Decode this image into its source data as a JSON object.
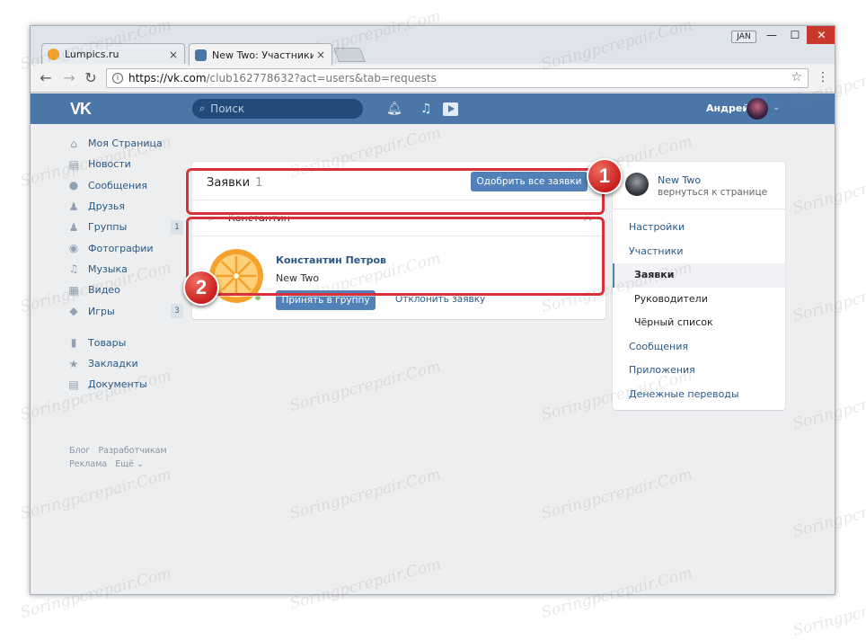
{
  "browser": {
    "tabs": [
      {
        "title": "Lumpics.ru",
        "favicon_color": "#f5a22d"
      },
      {
        "title": "New Two: Участники",
        "favicon_color": "#4a76a8"
      }
    ],
    "close_glyph": "×",
    "user_badge": "JAN",
    "window_controls": {
      "minimize": "—",
      "maximize": "☐",
      "close": "✕"
    },
    "url_host": "https://vk.com",
    "url_path": "/club162778632?act=users&tab=requests"
  },
  "vk_header": {
    "logo": "VK",
    "search_placeholder": "Поиск",
    "user_name": "Андрей"
  },
  "left_nav": {
    "items": [
      {
        "label": "Моя Страница",
        "icon": "home-icon",
        "glyph": "⌂",
        "count": ""
      },
      {
        "label": "Новости",
        "icon": "news-icon",
        "glyph": "▤",
        "count": ""
      },
      {
        "label": "Сообщения",
        "icon": "messages-icon",
        "glyph": "●",
        "count": ""
      },
      {
        "label": "Друзья",
        "icon": "friends-icon",
        "glyph": "♟",
        "count": ""
      },
      {
        "label": "Группы",
        "icon": "groups-icon",
        "glyph": "♟",
        "count": "1"
      },
      {
        "label": "Фотографии",
        "icon": "camera-icon",
        "glyph": "◉",
        "count": ""
      },
      {
        "label": "Музыка",
        "icon": "music-icon",
        "glyph": "♫",
        "count": ""
      },
      {
        "label": "Видео",
        "icon": "video-icon",
        "glyph": "▦",
        "count": ""
      },
      {
        "label": "Игры",
        "icon": "games-icon",
        "glyph": "◆",
        "count": "3"
      }
    ],
    "items2": [
      {
        "label": "Товары",
        "icon": "bag-icon",
        "glyph": "▮"
      },
      {
        "label": "Закладки",
        "icon": "star-icon",
        "glyph": "★"
      },
      {
        "label": "Документы",
        "icon": "document-icon",
        "glyph": "▤"
      }
    ],
    "footer": {
      "blog": "Блог",
      "dev": "Разработчикам",
      "ads": "Реклама",
      "more": "Ещё ⌄"
    }
  },
  "requests": {
    "title": "Заявки",
    "count": "1",
    "approve_all": "Одобрить все заявки",
    "search_value": "Константин",
    "request": {
      "name": "Константин Петров",
      "group": "New Two",
      "accept": "Принять в группу",
      "decline": "Отклонить заявку"
    }
  },
  "right_menu": {
    "group_name": "New Two",
    "back": "вернуться к странице",
    "items": [
      {
        "label": "Настройки",
        "kind": "top"
      },
      {
        "label": "Участники",
        "kind": "top"
      },
      {
        "label": "Заявки",
        "kind": "selected"
      },
      {
        "label": "Руководители",
        "kind": "sub"
      },
      {
        "label": "Чёрный список",
        "kind": "sub"
      },
      {
        "label": "Сообщения",
        "kind": "top"
      },
      {
        "label": "Приложения",
        "kind": "top"
      },
      {
        "label": "Денежные переводы",
        "kind": "top"
      }
    ]
  },
  "callouts": {
    "one": "1",
    "two": "2",
    "color": "#d8313a"
  },
  "watermark": "Soringpcrepair.Com",
  "colors": {
    "vk_blue": "#4a76a8",
    "button_blue": "#5181b8",
    "link": "#2a5885",
    "page_bg": "#edeef0"
  }
}
